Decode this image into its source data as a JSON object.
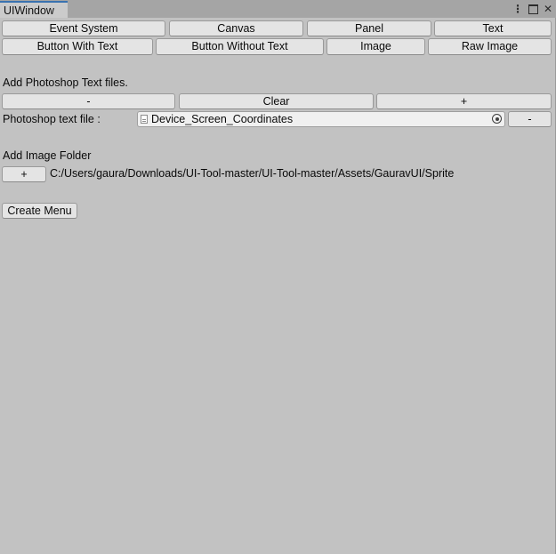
{
  "window": {
    "tab_title": "UIWindow"
  },
  "row1": {
    "event_system": "Event System",
    "canvas": "Canvas",
    "panel": "Panel",
    "text": "Text"
  },
  "row2": {
    "button_with_text": "Button With Text",
    "button_without_text": "Button Without Text",
    "image": "Image",
    "raw_image": "Raw Image"
  },
  "photoshop": {
    "section_label": "Add Photoshop Text files.",
    "minus_label": "-",
    "clear_label": "Clear",
    "plus_label": "+",
    "field_label": "Photoshop text file :",
    "field_value": "Device_Screen_Coordinates",
    "remove_label": "-"
  },
  "image_folder": {
    "section_label": "Add Image Folder",
    "add_label": "+",
    "path": "C:/Users/gaura/Downloads/UI-Tool-master/UI-Tool-master/Assets/GauravUI/Sprite"
  },
  "create_menu_label": "Create Menu"
}
